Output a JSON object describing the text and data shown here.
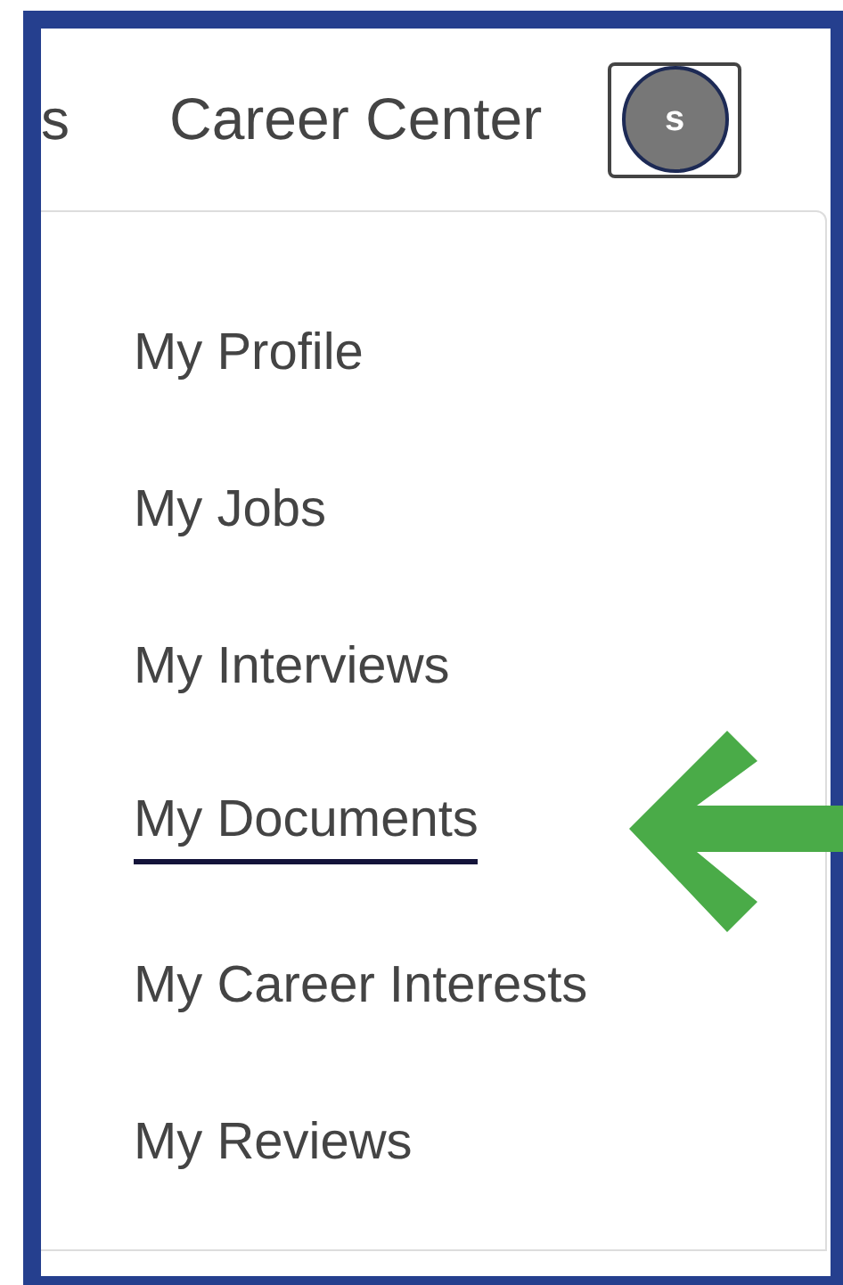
{
  "nav": {
    "cut_tab": "s",
    "link": "Career Center",
    "avatar_initial": "s"
  },
  "menu": [
    {
      "label": "My Profile",
      "selected": false
    },
    {
      "label": "My Jobs",
      "selected": false
    },
    {
      "label": "My Interviews",
      "selected": false
    },
    {
      "label": "My Documents",
      "selected": true
    },
    {
      "label": "My Career Interests",
      "selected": false
    },
    {
      "label": "My Reviews",
      "selected": false
    }
  ]
}
